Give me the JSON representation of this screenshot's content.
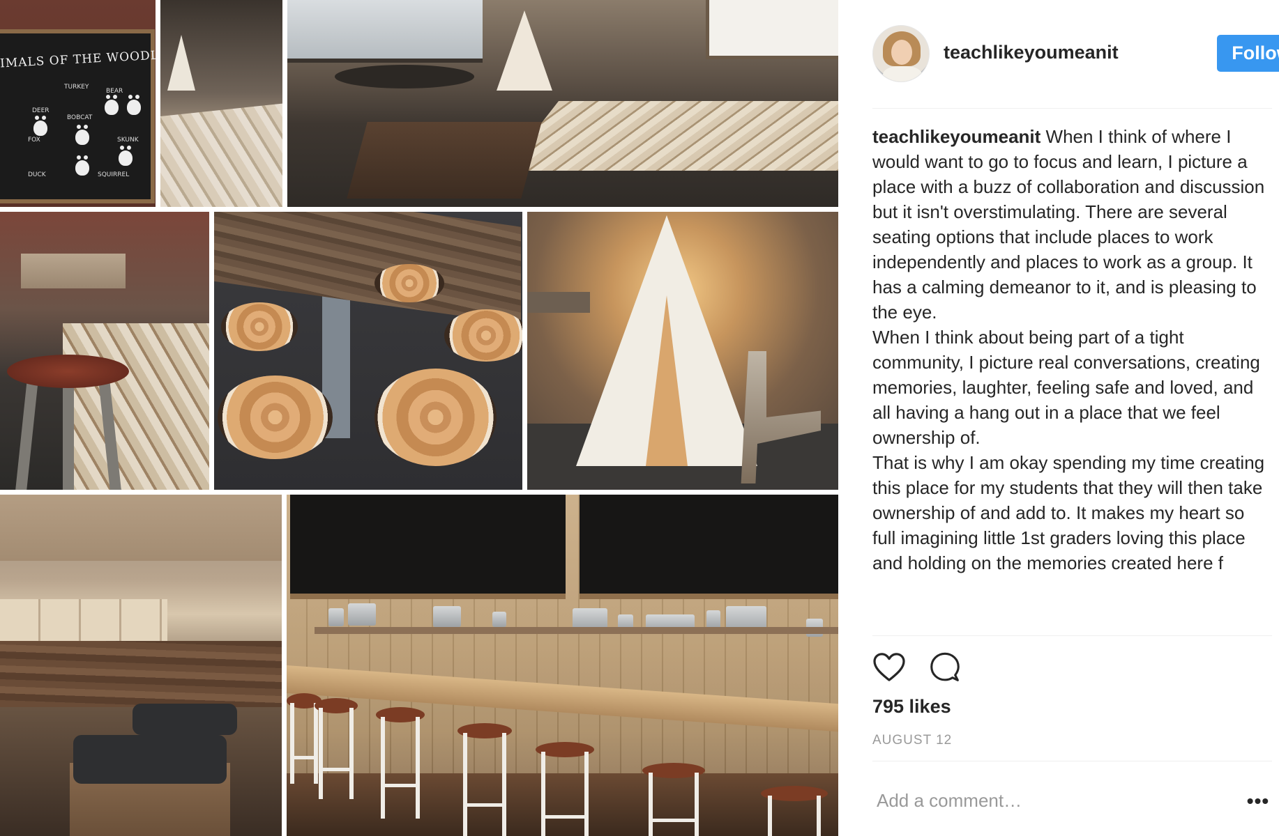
{
  "post": {
    "username": "teachlikeyoumeanit",
    "follow_label": "Follow",
    "caption_username": "teachlikeyoumeanit",
    "caption_text": " When I think of where I would want to go to focus and learn, I picture a place with a buzz of collaboration and discussion but it isn't overstimulating. There are several seating options that include places to work independently and places to work as a group. It has a calming demeanor to it, and is pleasing to the eye.\nWhen I think about being part of a tight community, I picture real conversations, creating memories, laughter, feeling safe and loved, and all having a hang out in a place that we feel ownership of.\nThat is why I am okay spending my time creating this place for my students that they will then take ownership of and add to. It makes my heart so full imagining little 1st graders loving this place and holding on the memories created here f",
    "likes": "795 likes",
    "date": "AUGUST 12",
    "comment_placeholder": "Add a comment…",
    "more_label": "•••"
  },
  "collage": {
    "chalkboard_title": "IMALS OF THE WOODLANDS",
    "chalkboard_labels": [
      "TURKEY",
      "BEAR",
      "DEER",
      "BOBCAT",
      "FOX",
      "SKUNK",
      "DUCK",
      "SQUIRREL"
    ]
  },
  "icons": {
    "like": "heart-icon",
    "comment": "comment-bubble-icon",
    "more": "more-options-icon"
  },
  "colors": {
    "follow_button": "#3897f0",
    "text": "#262626",
    "muted": "#999999",
    "divider": "#efefef"
  }
}
